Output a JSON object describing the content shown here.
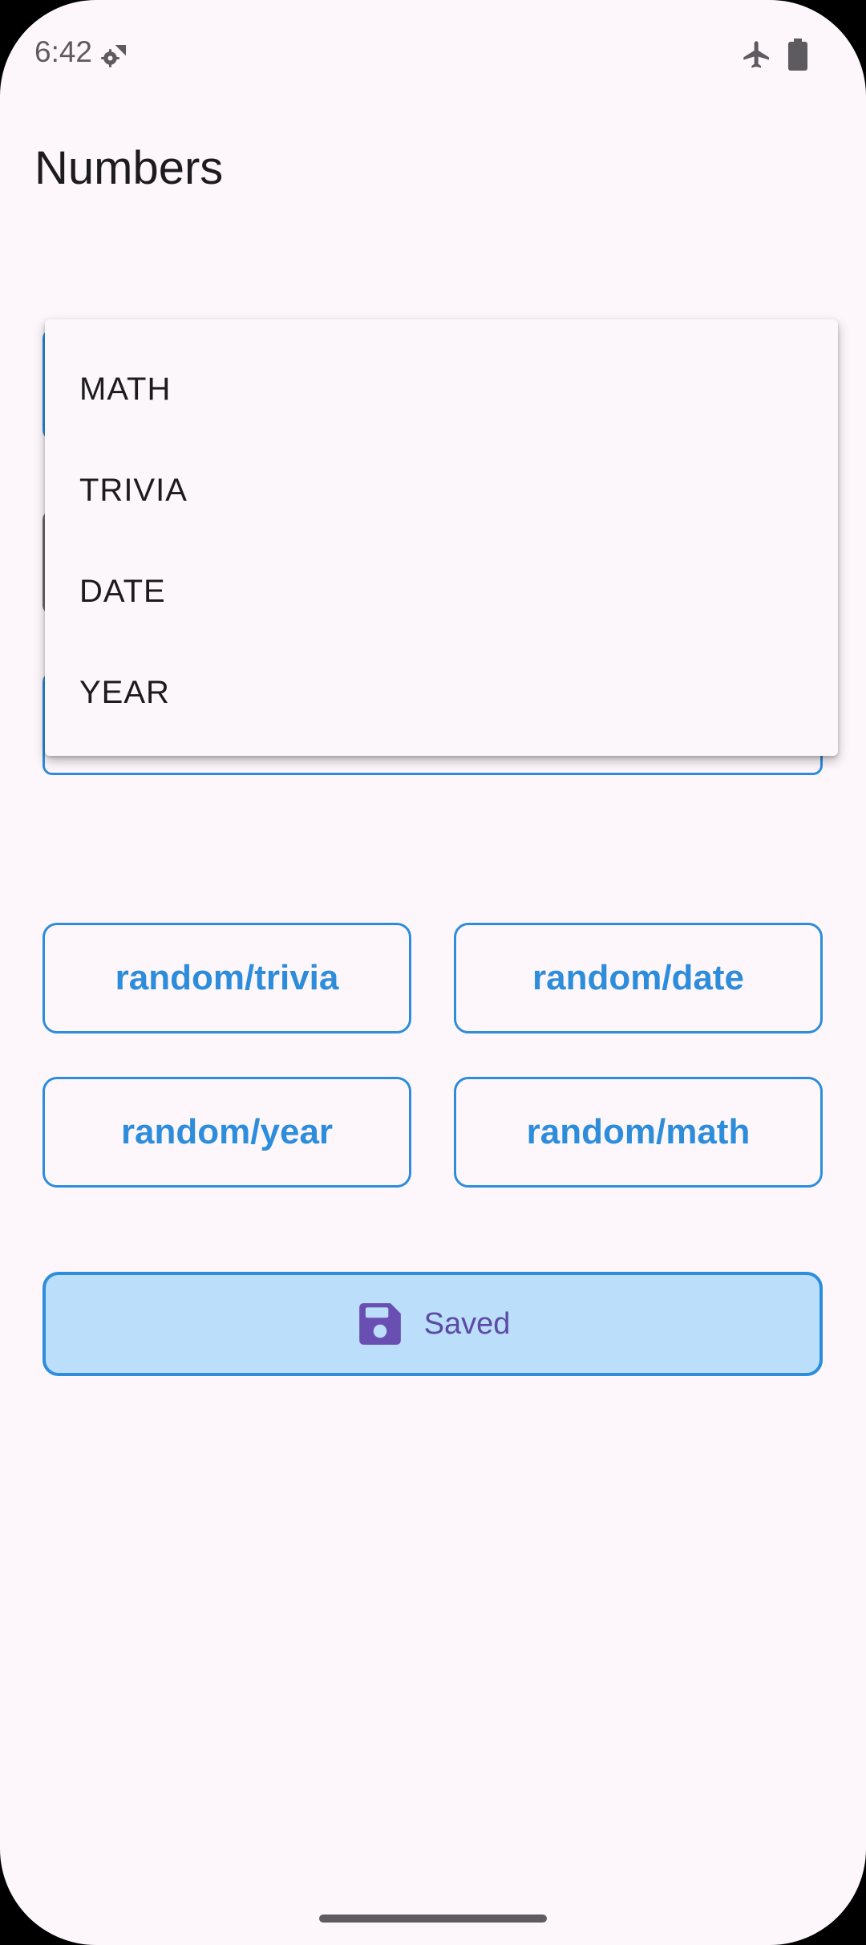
{
  "status_bar": {
    "time": "6:42",
    "icons": [
      "settings-wifi-icon",
      "airplane-icon",
      "battery-icon"
    ]
  },
  "app_bar": {
    "title": "Numbers"
  },
  "dropdown": {
    "options": [
      "MATH",
      "TRIVIA",
      "DATE",
      "YEAR"
    ]
  },
  "random_buttons": {
    "trivia": "random/trivia",
    "date": "random/date",
    "year": "random/year",
    "math": "random/math"
  },
  "saved_button": {
    "label": "Saved",
    "icon": "floppy-disk-icon"
  },
  "colors": {
    "accent": "#2e8ddb",
    "saved_bg": "#bbdefa",
    "saved_fg": "#5c4aa5",
    "background": "#fdf7fc"
  }
}
